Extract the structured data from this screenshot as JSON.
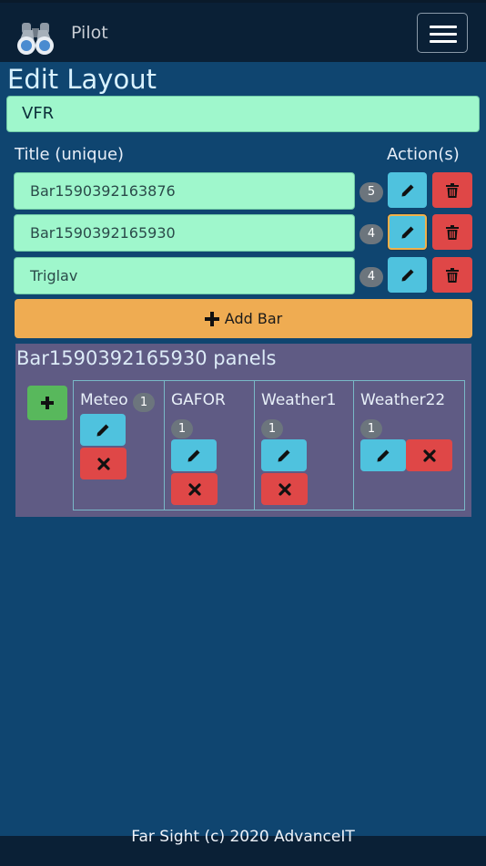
{
  "app": {
    "name": "Pilot",
    "icon": "binoculars-icon",
    "menu_icon": "hamburger-icon"
  },
  "page": {
    "title": "Edit Layout"
  },
  "layout": {
    "name": "VFR"
  },
  "columns": {
    "title": "Title (unique)",
    "actions": "Action(s)"
  },
  "bars": [
    {
      "title": "Bar1590392163876",
      "count": "5"
    },
    {
      "title": "Bar1590392165930",
      "count": "4"
    },
    {
      "title": "Triglav",
      "count": "4"
    }
  ],
  "add_bar": {
    "label": "Add Bar"
  },
  "panels": {
    "title": "Bar1590392165930 panels",
    "items": [
      {
        "name": "Meteo",
        "count": "1"
      },
      {
        "name": "GAFOR",
        "count": "1"
      },
      {
        "name": "Weather1",
        "count": "1"
      },
      {
        "name": "Weather22",
        "count": "1"
      }
    ]
  },
  "footer": {
    "text": "Far Sight (c) 2020 AdvanceIT"
  },
  "colors": {
    "background": "#0f4570",
    "navbar": "#0a2036",
    "input": "#9ff7cc",
    "edit": "#4fc2de",
    "delete": "#df4747",
    "add_bar": "#efac52",
    "add_panel": "#58b85c",
    "panels_card": "#5f5b84"
  }
}
